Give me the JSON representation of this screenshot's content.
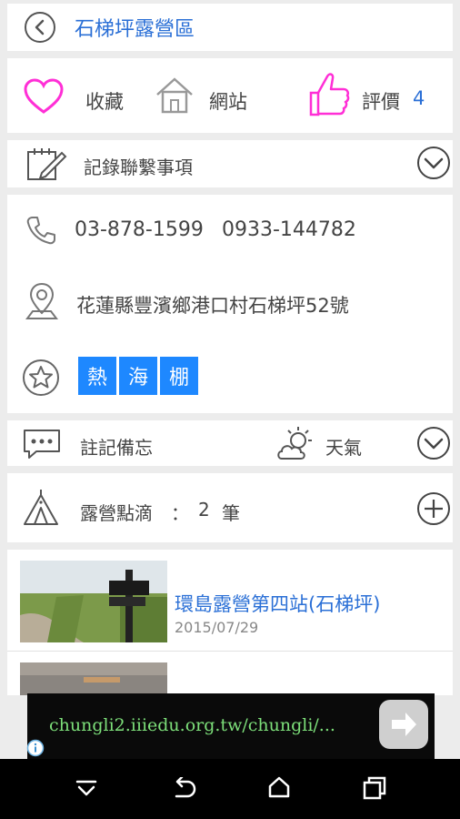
{
  "header": {
    "title": "石梯坪露營區"
  },
  "actions": {
    "favorite_label": "收藏",
    "website_label": "網站",
    "rating_label": "評價",
    "rating_count": "4"
  },
  "contact_note": {
    "label": "記錄聯繫事項"
  },
  "info": {
    "phone1": "03-878-1599",
    "phone2": "0933-144782",
    "address": "花蓮縣豐濱鄉港口村石梯坪52號",
    "tags": [
      "熱",
      "海",
      "棚"
    ]
  },
  "notes": {
    "memo_label": "註記備忘",
    "weather_label": "天氣"
  },
  "camp_records": {
    "label": "露營點滴",
    "sep": "：",
    "count": "2",
    "unit": "筆"
  },
  "posts": [
    {
      "title": "環島露營第四站(石梯坪)",
      "date": "2015/07/29"
    }
  ],
  "ad": {
    "url": "chungli2.iiiedu.org.tw/chungli/..."
  },
  "colors": {
    "link_blue": "#2a6fd6",
    "tag_blue": "#1e88ff",
    "heart_magenta": "#ff2fd6",
    "ad_green": "#7de07a"
  }
}
